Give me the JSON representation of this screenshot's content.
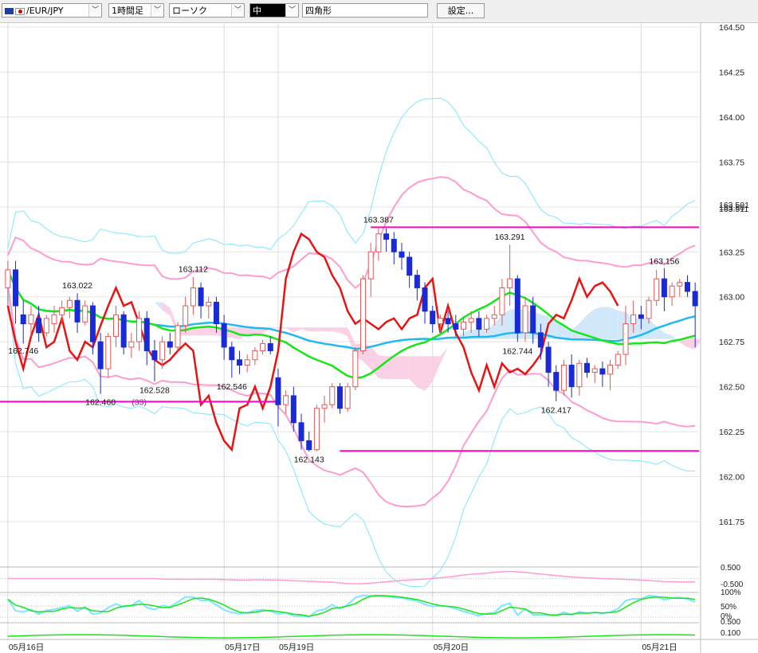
{
  "toolbar": {
    "pair": "EUR/JPY",
    "pair_prefix": "/",
    "timeframe": "1時間足",
    "chart_type": "ローソク",
    "size": "中",
    "drawing": "四角形",
    "settings": "設定..."
  },
  "colors": {
    "up": "#e05a5a",
    "down": "#1a2bd6",
    "magenta": "#ff00c8",
    "green": "#19e619",
    "sky": "#22b8f0",
    "cyan": "#7fe6ff",
    "pink": "#ff9ccf",
    "red": "#e81414",
    "cloud_pink": "#f9c9e0",
    "cloud_blue": "#c8e4f8"
  },
  "chart_data": {
    "type": "candlestick",
    "pair": "EUR/JPY",
    "timeframe": "1h",
    "y_axis": {
      "min": 161.75,
      "max": 164.5,
      "ticks": [
        "164.50",
        "164.25",
        "164.00",
        "163.75",
        "163.50",
        "163.25",
        "163.00",
        "162.75",
        "162.50",
        "162.25",
        "162.00",
        "161.75"
      ]
    },
    "current_price_labels": [
      "163.501",
      "163.511"
    ],
    "date_labels": [
      {
        "label": "05月16日",
        "index": 0
      },
      {
        "label": "05月17日",
        "index": 28
      },
      {
        "label": "05月19日",
        "index": 35
      },
      {
        "label": "05月20日",
        "index": 55
      },
      {
        "label": "05月21日",
        "index": 82
      }
    ],
    "annotations": [
      {
        "text": "162.746",
        "index": 2,
        "price": 162.746,
        "pos": "below"
      },
      {
        "text": "163.022",
        "index": 9,
        "price": 163.022,
        "pos": "above"
      },
      {
        "text": "162.460",
        "index": 12,
        "price": 162.46,
        "pos": "below"
      },
      {
        "text": "(33)",
        "index": 17,
        "price": 162.46,
        "pos": "below",
        "purple": true
      },
      {
        "text": "162.528",
        "index": 19,
        "price": 162.528,
        "pos": "below"
      },
      {
        "text": "163.112",
        "index": 24,
        "price": 163.112,
        "pos": "above"
      },
      {
        "text": "162.546",
        "index": 29,
        "price": 162.546,
        "pos": "below"
      },
      {
        "text": "162.143",
        "index": 39,
        "price": 162.143,
        "pos": "below"
      },
      {
        "text": "163.387",
        "index": 48,
        "price": 163.387,
        "pos": "above"
      },
      {
        "text": "163.291",
        "index": 65,
        "price": 163.291,
        "pos": "above"
      },
      {
        "text": "162.744",
        "index": 66,
        "price": 162.744,
        "pos": "below"
      },
      {
        "text": "162.417",
        "index": 71,
        "price": 162.417,
        "pos": "below"
      },
      {
        "text": "163.156",
        "index": 85,
        "price": 163.156,
        "pos": "above"
      }
    ],
    "horizontal_lines": [
      {
        "price": 163.387,
        "from": 47,
        "to": 90
      },
      {
        "price": 162.417,
        "from": 0,
        "to": 35
      },
      {
        "price": 162.143,
        "from": 43,
        "to": 90
      }
    ],
    "candles": [
      {
        "o": 163.05,
        "h": 163.2,
        "c": 163.15,
        "l": 162.95
      },
      {
        "o": 163.15,
        "h": 163.2,
        "c": 162.95,
        "l": 162.85
      },
      {
        "o": 162.9,
        "h": 162.98,
        "c": 162.85,
        "l": 162.74
      },
      {
        "o": 162.85,
        "h": 162.95,
        "c": 162.9,
        "l": 162.78
      },
      {
        "o": 162.88,
        "h": 162.95,
        "c": 162.8,
        "l": 162.75
      },
      {
        "o": 162.8,
        "h": 162.9,
        "c": 162.88,
        "l": 162.78
      },
      {
        "o": 162.85,
        "h": 162.95,
        "c": 162.9,
        "l": 162.8
      },
      {
        "o": 162.9,
        "h": 162.98,
        "c": 162.94,
        "l": 162.85
      },
      {
        "o": 162.94,
        "h": 163.0,
        "c": 162.98,
        "l": 162.88
      },
      {
        "o": 162.98,
        "h": 163.02,
        "c": 162.86,
        "l": 162.8
      },
      {
        "o": 162.86,
        "h": 162.98,
        "c": 162.95,
        "l": 162.84
      },
      {
        "o": 162.95,
        "h": 162.97,
        "c": 162.75,
        "l": 162.68
      },
      {
        "o": 162.75,
        "h": 162.8,
        "c": 162.6,
        "l": 162.46
      },
      {
        "o": 162.6,
        "h": 162.8,
        "c": 162.78,
        "l": 162.55
      },
      {
        "o": 162.78,
        "h": 162.95,
        "c": 162.9,
        "l": 162.72
      },
      {
        "o": 162.9,
        "h": 162.92,
        "c": 162.72,
        "l": 162.68
      },
      {
        "o": 162.72,
        "h": 162.8,
        "c": 162.75,
        "l": 162.66
      },
      {
        "o": 162.75,
        "h": 162.92,
        "c": 162.88,
        "l": 162.7
      },
      {
        "o": 162.88,
        "h": 162.92,
        "c": 162.7,
        "l": 162.62
      },
      {
        "o": 162.7,
        "h": 162.76,
        "c": 162.65,
        "l": 162.53
      },
      {
        "o": 162.65,
        "h": 162.78,
        "c": 162.75,
        "l": 162.6
      },
      {
        "o": 162.75,
        "h": 162.8,
        "c": 162.72,
        "l": 162.68
      },
      {
        "o": 162.72,
        "h": 162.86,
        "c": 162.84,
        "l": 162.7
      },
      {
        "o": 162.84,
        "h": 163.0,
        "c": 162.95,
        "l": 162.8
      },
      {
        "o": 162.95,
        "h": 163.11,
        "c": 163.05,
        "l": 162.9
      },
      {
        "o": 163.05,
        "h": 163.08,
        "c": 162.95,
        "l": 162.88
      },
      {
        "o": 162.95,
        "h": 163.0,
        "c": 162.97,
        "l": 162.88
      },
      {
        "o": 162.97,
        "h": 163.0,
        "c": 162.85,
        "l": 162.8
      },
      {
        "o": 162.85,
        "h": 162.9,
        "c": 162.72,
        "l": 162.65
      },
      {
        "o": 162.72,
        "h": 162.75,
        "c": 162.65,
        "l": 162.55
      },
      {
        "o": 162.65,
        "h": 162.7,
        "c": 162.62,
        "l": 162.57
      },
      {
        "o": 162.62,
        "h": 162.68,
        "c": 162.65,
        "l": 162.58
      },
      {
        "o": 162.65,
        "h": 162.72,
        "c": 162.7,
        "l": 162.62
      },
      {
        "o": 162.7,
        "h": 162.76,
        "c": 162.74,
        "l": 162.68
      },
      {
        "o": 162.74,
        "h": 162.78,
        "c": 162.7,
        "l": 162.68
      },
      {
        "o": 162.55,
        "h": 162.6,
        "c": 162.4,
        "l": 162.28
      },
      {
        "o": 162.4,
        "h": 162.48,
        "c": 162.45,
        "l": 162.35
      },
      {
        "o": 162.45,
        "h": 162.5,
        "c": 162.3,
        "l": 162.25
      },
      {
        "o": 162.3,
        "h": 162.35,
        "c": 162.2,
        "l": 162.15
      },
      {
        "o": 162.2,
        "h": 162.25,
        "c": 162.15,
        "l": 162.14
      },
      {
        "o": 162.15,
        "h": 162.4,
        "c": 162.38,
        "l": 162.14
      },
      {
        "o": 162.38,
        "h": 162.45,
        "c": 162.4,
        "l": 162.3
      },
      {
        "o": 162.4,
        "h": 162.52,
        "c": 162.5,
        "l": 162.38
      },
      {
        "o": 162.5,
        "h": 162.52,
        "c": 162.38,
        "l": 162.35
      },
      {
        "o": 162.38,
        "h": 162.52,
        "c": 162.5,
        "l": 162.36
      },
      {
        "o": 162.5,
        "h": 162.72,
        "c": 162.7,
        "l": 162.48
      },
      {
        "o": 162.7,
        "h": 163.12,
        "c": 163.1,
        "l": 162.68
      },
      {
        "o": 163.1,
        "h": 163.3,
        "c": 163.25,
        "l": 163.0
      },
      {
        "o": 163.25,
        "h": 163.39,
        "c": 163.35,
        "l": 163.2
      },
      {
        "o": 163.35,
        "h": 163.38,
        "c": 163.32,
        "l": 163.25
      },
      {
        "o": 163.32,
        "h": 163.36,
        "c": 163.25,
        "l": 163.18
      },
      {
        "o": 163.25,
        "h": 163.3,
        "c": 163.22,
        "l": 163.15
      },
      {
        "o": 163.22,
        "h": 163.25,
        "c": 163.12,
        "l": 163.05
      },
      {
        "o": 163.12,
        "h": 163.15,
        "c": 163.05,
        "l": 162.98
      },
      {
        "o": 163.05,
        "h": 163.08,
        "c": 162.92,
        "l": 162.85
      },
      {
        "o": 162.92,
        "h": 162.95,
        "c": 162.85,
        "l": 162.8
      },
      {
        "o": 162.85,
        "h": 162.9,
        "c": 162.88,
        "l": 162.8
      },
      {
        "o": 162.88,
        "h": 162.92,
        "c": 162.85,
        "l": 162.8
      },
      {
        "o": 162.85,
        "h": 162.9,
        "c": 162.82,
        "l": 162.78
      },
      {
        "o": 162.82,
        "h": 162.88,
        "c": 162.86,
        "l": 162.78
      },
      {
        "o": 162.86,
        "h": 162.92,
        "c": 162.88,
        "l": 162.8
      },
      {
        "o": 162.88,
        "h": 162.92,
        "c": 162.82,
        "l": 162.78
      },
      {
        "o": 162.82,
        "h": 162.9,
        "c": 162.88,
        "l": 162.8
      },
      {
        "o": 162.88,
        "h": 162.95,
        "c": 162.9,
        "l": 162.84
      },
      {
        "o": 162.9,
        "h": 163.1,
        "c": 163.05,
        "l": 162.84
      },
      {
        "o": 163.05,
        "h": 163.29,
        "c": 163.1,
        "l": 162.95
      },
      {
        "o": 163.1,
        "h": 163.12,
        "c": 162.8,
        "l": 162.75
      },
      {
        "o": 162.8,
        "h": 163.0,
        "c": 162.95,
        "l": 162.75
      },
      {
        "o": 162.95,
        "h": 163.0,
        "c": 162.8,
        "l": 162.74
      },
      {
        "o": 162.8,
        "h": 162.85,
        "c": 162.72,
        "l": 162.65
      },
      {
        "o": 162.72,
        "h": 162.75,
        "c": 162.58,
        "l": 162.5
      },
      {
        "o": 162.58,
        "h": 162.62,
        "c": 162.48,
        "l": 162.42
      },
      {
        "o": 162.48,
        "h": 162.65,
        "c": 162.62,
        "l": 162.45
      },
      {
        "o": 162.62,
        "h": 162.68,
        "c": 162.5,
        "l": 162.44
      },
      {
        "o": 162.5,
        "h": 162.65,
        "c": 162.63,
        "l": 162.45
      },
      {
        "o": 162.63,
        "h": 162.66,
        "c": 162.58,
        "l": 162.55
      },
      {
        "o": 162.58,
        "h": 162.62,
        "c": 162.6,
        "l": 162.52
      },
      {
        "o": 162.6,
        "h": 162.64,
        "c": 162.57,
        "l": 162.5
      },
      {
        "o": 162.57,
        "h": 162.65,
        "c": 162.62,
        "l": 162.48
      },
      {
        "o": 162.62,
        "h": 162.7,
        "c": 162.68,
        "l": 162.6
      },
      {
        "o": 162.68,
        "h": 162.95,
        "c": 162.85,
        "l": 162.62
      },
      {
        "o": 162.85,
        "h": 162.98,
        "c": 162.9,
        "l": 162.8
      },
      {
        "o": 162.9,
        "h": 162.95,
        "c": 162.88,
        "l": 162.82
      },
      {
        "o": 162.88,
        "h": 163.0,
        "c": 162.98,
        "l": 162.85
      },
      {
        "o": 162.98,
        "h": 163.15,
        "c": 163.1,
        "l": 162.95
      },
      {
        "o": 163.1,
        "h": 163.16,
        "c": 163.0,
        "l": 162.92
      },
      {
        "o": 163.0,
        "h": 163.08,
        "c": 163.06,
        "l": 162.95
      },
      {
        "o": 163.06,
        "h": 163.1,
        "c": 163.08,
        "l": 163.0
      },
      {
        "o": 163.08,
        "h": 163.12,
        "c": 163.03,
        "l": 163.0
      },
      {
        "o": 163.03,
        "h": 163.08,
        "c": 162.95,
        "l": 162.72
      }
    ],
    "oscillator_levels": {
      "panel1": [
        "0.500",
        "-0.500"
      ],
      "panel2": [
        "100%",
        "50%",
        "0%"
      ],
      "panel3": [
        "0.500",
        "0.100"
      ]
    }
  }
}
